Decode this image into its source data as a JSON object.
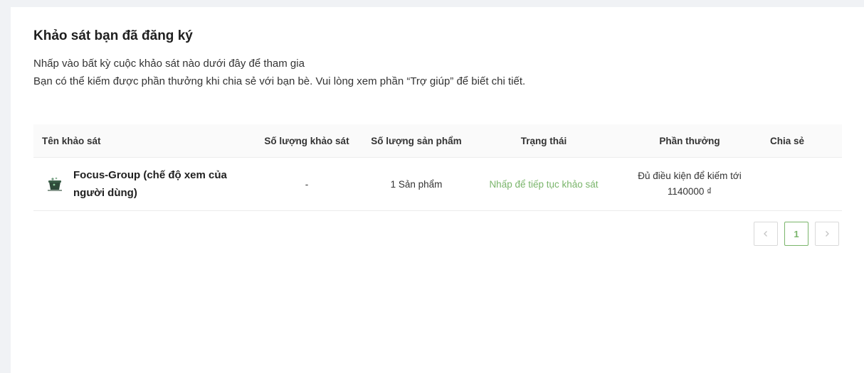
{
  "page": {
    "title": "Khảo sát bạn đã đăng ký",
    "description_line1": "Nhấp vào bất kỳ cuộc khảo sát nào dưới đây để tham gia",
    "description_line2": "Bạn có thể kiếm được phần thưởng khi chia sẻ với bạn bè. Vui lòng xem phần “Trợ giúp” để biết chi tiết."
  },
  "table": {
    "headers": {
      "name": "Tên khảo sát",
      "survey_count": "Số lượng khảo sát",
      "product_count": "Số lượng sản phẩm",
      "status": "Trạng thái",
      "reward": "Phần thưởng",
      "share": "Chia sẻ"
    },
    "rows": [
      {
        "icon": "survey-thumbnail-icon",
        "name": "Focus-Group (chế độ xem của người dùng)",
        "survey_count": "-",
        "product_count": "1 Sản phẩm",
        "status": "Nhấp để tiếp tục khảo sát",
        "reward_line1": "Đủ điều kiện để kiếm tới",
        "reward_line2": "1140000 ₫",
        "share": ""
      }
    ]
  },
  "pagination": {
    "prev_icon": "chevron-left-icon",
    "current_page": "1",
    "next_icon": "chevron-right-icon"
  },
  "colors": {
    "accent": "#7ab56b",
    "background": "#f0f2f5",
    "card": "#ffffff"
  }
}
